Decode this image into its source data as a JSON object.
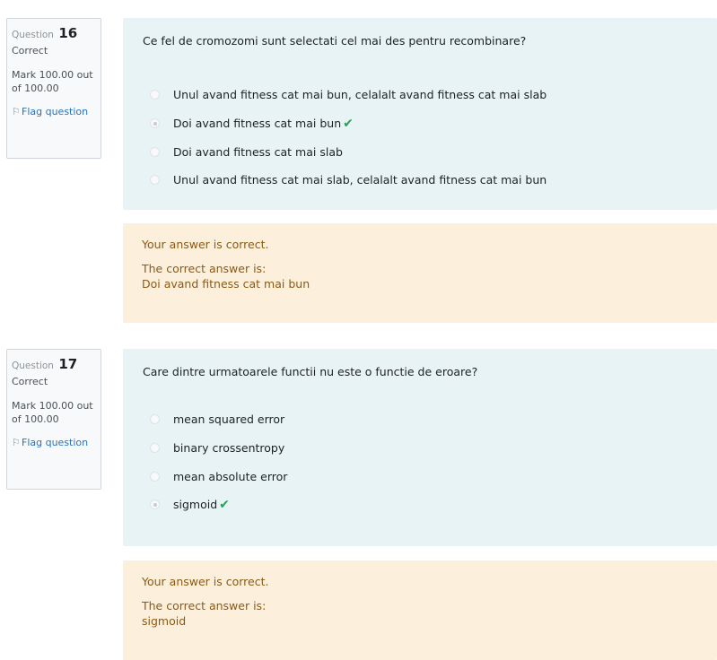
{
  "questions": [
    {
      "label": "Question",
      "number": "16",
      "state": "Correct",
      "grade": "Mark 100.00 out of 100.00",
      "flag": "Flag question",
      "text": "Ce fel de cromozomi sunt selectati cel mai des pentru recombinare?",
      "answers": [
        {
          "text": "Unul avand fitness cat mai bun, celalalt avand fitness cat mai slab",
          "selected": false,
          "correct_mark": ""
        },
        {
          "text": "Doi avand fitness cat mai bun",
          "selected": true,
          "correct_mark": "✔"
        },
        {
          "text": "Doi avand fitness cat mai slab",
          "selected": false,
          "correct_mark": ""
        },
        {
          "text": "Unul avand fitness cat mai slab, celalalt avand fitness cat mai bun",
          "selected": false,
          "correct_mark": ""
        }
      ],
      "feedback": "Your answer is correct.",
      "right_answer_label": "The correct answer is:",
      "right_answer": "Doi avand fitness cat mai bun"
    },
    {
      "label": "Question",
      "number": "17",
      "state": "Correct",
      "grade": "Mark 100.00 out of 100.00",
      "flag": "Flag question",
      "text": "Care dintre urmatoarele functii nu este o functie de eroare?",
      "answers": [
        {
          "text": "mean squared error",
          "selected": false,
          "correct_mark": ""
        },
        {
          "text": "binary crossentropy",
          "selected": false,
          "correct_mark": ""
        },
        {
          "text": "mean absolute error",
          "selected": false,
          "correct_mark": ""
        },
        {
          "text": "sigmoid",
          "selected": true,
          "correct_mark": "✔"
        }
      ],
      "feedback": "Your answer is correct.",
      "right_answer_label": "The correct answer is:",
      "right_answer": "sigmoid"
    }
  ],
  "colors": {
    "formulation_bg": "#e7f3f5",
    "outcome_bg": "#fcefdc",
    "outcome_text": "#8a5a14",
    "check": "#26a155",
    "link": "#2a73b8"
  },
  "icons": {
    "flag": "flag-icon",
    "check": "check-icon"
  }
}
